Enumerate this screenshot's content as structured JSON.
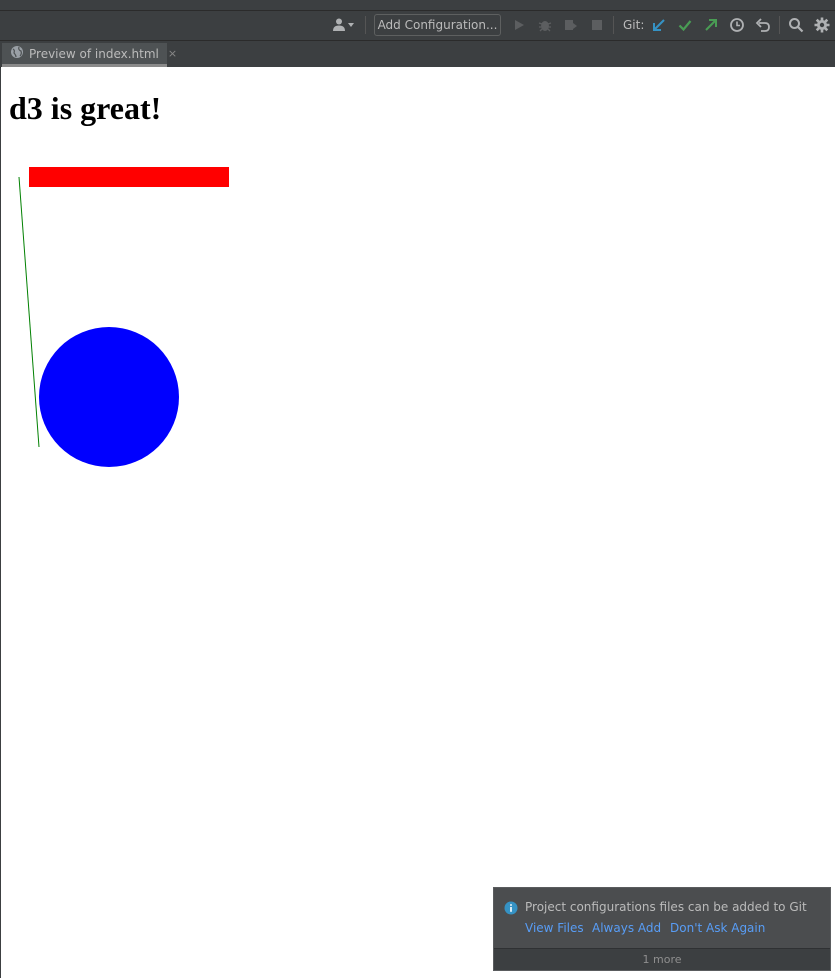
{
  "toolbar": {
    "add_configuration_label": "Add Configuration...",
    "git_label": "Git:",
    "icons": [
      "user-dropdown-icon",
      "run-icon",
      "debug-icon",
      "coverage-icon",
      "stop-icon",
      "git-update-icon",
      "git-commit-icon",
      "git-push-icon",
      "history-icon",
      "rollback-icon",
      "search-icon",
      "settings-icon"
    ],
    "colors": {
      "git_update": "#3592c4",
      "git_commit": "#499c54",
      "git_push": "#499c54",
      "icon_default": "#afb1b3",
      "icon_disabled": "#5c5e60"
    }
  },
  "tabs": [
    {
      "label": "Preview of index.html",
      "icon": "web-preview-icon",
      "close": "×"
    }
  ],
  "page": {
    "heading": "d3 is great!",
    "shapes": {
      "rect_color": "#ff0000",
      "line_color": "#008000",
      "circle_color": "#0000ff"
    }
  },
  "notification": {
    "icon": "info-icon",
    "message": "Project configurations files can be added to Git",
    "actions": {
      "view_files": "View Files",
      "always_add": "Always Add",
      "dont_ask": "Don't Ask Again"
    },
    "footer": "1 more"
  }
}
